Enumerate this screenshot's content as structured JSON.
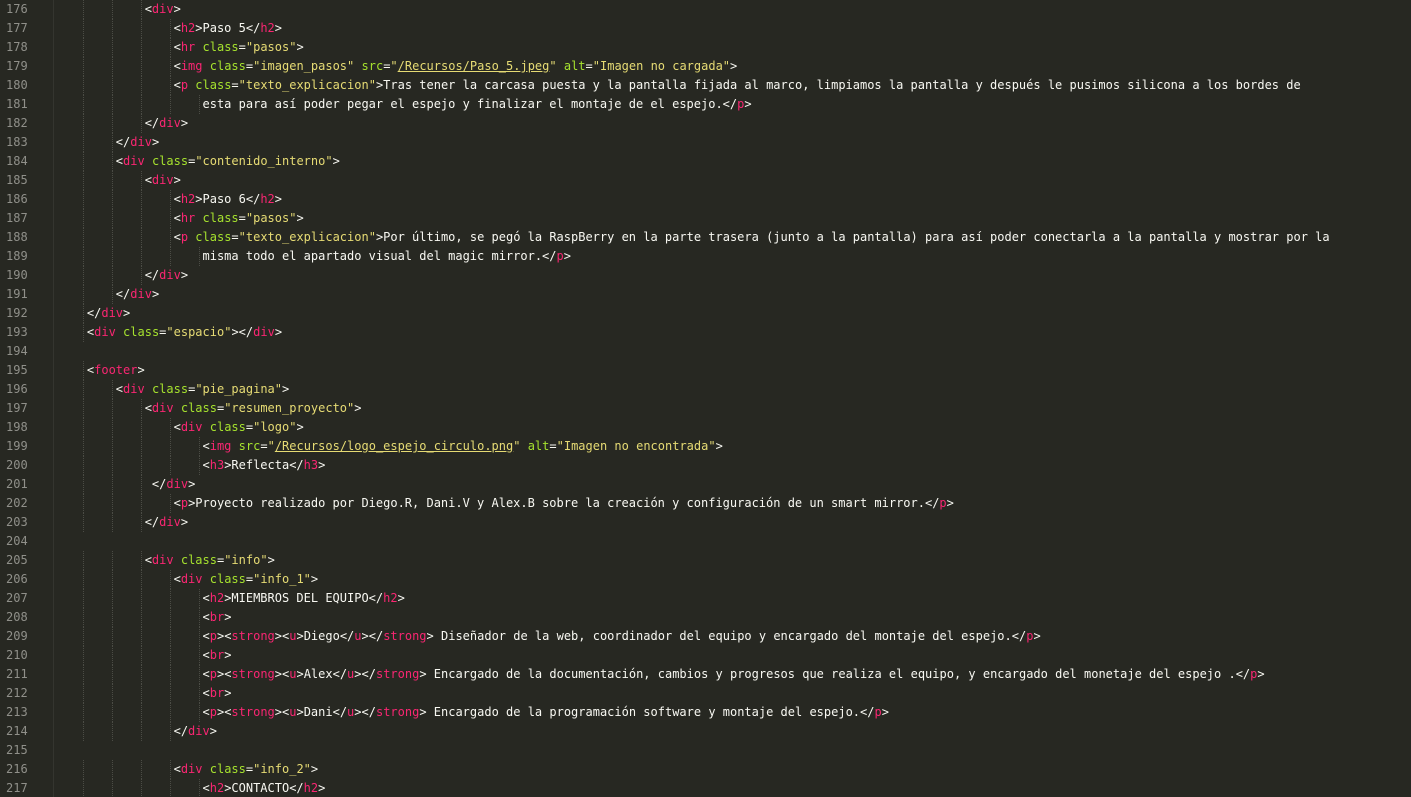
{
  "editor": {
    "theme": "monokai",
    "colors": {
      "background": "#272822",
      "tag": "#f92672",
      "attribute": "#a6e22e",
      "string": "#e6db74",
      "text": "#f8f8f2",
      "line_number": "#90908a"
    }
  },
  "lines": [
    {
      "n": "176",
      "indent": 12,
      "toks": [
        [
          "p",
          "<"
        ],
        [
          "t",
          "div"
        ],
        [
          "p",
          ">"
        ]
      ]
    },
    {
      "n": "177",
      "indent": 16,
      "toks": [
        [
          "p",
          "<"
        ],
        [
          "t",
          "h2"
        ],
        [
          "p",
          ">Paso 5</"
        ],
        [
          "t",
          "h2"
        ],
        [
          "p",
          ">"
        ]
      ]
    },
    {
      "n": "178",
      "indent": 16,
      "toks": [
        [
          "p",
          "<"
        ],
        [
          "t",
          "hr"
        ],
        [
          "p",
          " "
        ],
        [
          "a",
          "class"
        ],
        [
          "p",
          "="
        ],
        [
          "s",
          "\"pasos\""
        ],
        [
          "p",
          ">"
        ]
      ]
    },
    {
      "n": "179",
      "indent": 16,
      "toks": [
        [
          "p",
          "<"
        ],
        [
          "t",
          "img"
        ],
        [
          "p",
          " "
        ],
        [
          "a",
          "class"
        ],
        [
          "p",
          "="
        ],
        [
          "s",
          "\"imagen_pasos\""
        ],
        [
          "p",
          " "
        ],
        [
          "a",
          "src"
        ],
        [
          "p",
          "="
        ],
        [
          "s",
          "\""
        ],
        [
          "u",
          "/Recursos/Paso_5.jpeg"
        ],
        [
          "s",
          "\""
        ],
        [
          "p",
          " "
        ],
        [
          "a",
          "alt"
        ],
        [
          "p",
          "="
        ],
        [
          "s",
          "\"Imagen no cargada\""
        ],
        [
          "p",
          ">"
        ]
      ]
    },
    {
      "n": "180",
      "indent": 16,
      "toks": [
        [
          "p",
          "<"
        ],
        [
          "t",
          "p"
        ],
        [
          "p",
          " "
        ],
        [
          "a",
          "class"
        ],
        [
          "p",
          "="
        ],
        [
          "s",
          "\"texto_explicacion\""
        ],
        [
          "p",
          ">Tras tener la carcasa puesta y la pantalla fijada al marco, limpiamos la pantalla y después le pusimos silicona a los bordes de"
        ]
      ]
    },
    {
      "n": "181",
      "indent": 20,
      "toks": [
        [
          "p",
          "esta para así poder pegar el espejo y finalizar el montaje de el espejo.</"
        ],
        [
          "t",
          "p"
        ],
        [
          "p",
          ">"
        ]
      ]
    },
    {
      "n": "182",
      "indent": 12,
      "toks": [
        [
          "p",
          "</"
        ],
        [
          "t",
          "div"
        ],
        [
          "p",
          ">"
        ]
      ]
    },
    {
      "n": "183",
      "indent": 8,
      "toks": [
        [
          "p",
          "</"
        ],
        [
          "t",
          "div"
        ],
        [
          "p",
          ">"
        ]
      ]
    },
    {
      "n": "184",
      "indent": 8,
      "toks": [
        [
          "p",
          "<"
        ],
        [
          "t",
          "div"
        ],
        [
          "p",
          " "
        ],
        [
          "a",
          "class"
        ],
        [
          "p",
          "="
        ],
        [
          "s",
          "\"contenido_interno\""
        ],
        [
          "p",
          ">"
        ]
      ]
    },
    {
      "n": "185",
      "indent": 12,
      "toks": [
        [
          "p",
          "<"
        ],
        [
          "t",
          "div"
        ],
        [
          "p",
          ">"
        ]
      ]
    },
    {
      "n": "186",
      "indent": 16,
      "toks": [
        [
          "p",
          "<"
        ],
        [
          "t",
          "h2"
        ],
        [
          "p",
          ">Paso 6</"
        ],
        [
          "t",
          "h2"
        ],
        [
          "p",
          ">"
        ]
      ]
    },
    {
      "n": "187",
      "indent": 16,
      "toks": [
        [
          "p",
          "<"
        ],
        [
          "t",
          "hr"
        ],
        [
          "p",
          " "
        ],
        [
          "a",
          "class"
        ],
        [
          "p",
          "="
        ],
        [
          "s",
          "\"pasos\""
        ],
        [
          "p",
          ">"
        ]
      ]
    },
    {
      "n": "188",
      "indent": 16,
      "toks": [
        [
          "p",
          "<"
        ],
        [
          "t",
          "p"
        ],
        [
          "p",
          " "
        ],
        [
          "a",
          "class"
        ],
        [
          "p",
          "="
        ],
        [
          "s",
          "\"texto_explicacion\""
        ],
        [
          "p",
          ">Por último, se pegó la RaspBerry en la parte trasera (junto a la pantalla) para así poder conectarla a la pantalla y mostrar por la"
        ]
      ]
    },
    {
      "n": "189",
      "indent": 20,
      "toks": [
        [
          "p",
          "misma todo el apartado visual del magic mirror.</"
        ],
        [
          "t",
          "p"
        ],
        [
          "p",
          ">"
        ]
      ]
    },
    {
      "n": "190",
      "indent": 12,
      "toks": [
        [
          "p",
          "</"
        ],
        [
          "t",
          "div"
        ],
        [
          "p",
          ">"
        ]
      ]
    },
    {
      "n": "191",
      "indent": 8,
      "toks": [
        [
          "p",
          "</"
        ],
        [
          "t",
          "div"
        ],
        [
          "p",
          ">"
        ]
      ]
    },
    {
      "n": "192",
      "indent": 4,
      "toks": [
        [
          "p",
          "</"
        ],
        [
          "t",
          "div"
        ],
        [
          "p",
          ">"
        ]
      ]
    },
    {
      "n": "193",
      "indent": 4,
      "toks": [
        [
          "p",
          "<"
        ],
        [
          "t",
          "div"
        ],
        [
          "p",
          " "
        ],
        [
          "a",
          "class"
        ],
        [
          "p",
          "="
        ],
        [
          "s",
          "\"espacio\""
        ],
        [
          "p",
          "></"
        ],
        [
          "t",
          "div"
        ],
        [
          "p",
          ">"
        ]
      ]
    },
    {
      "n": "194",
      "indent": 0,
      "toks": []
    },
    {
      "n": "195",
      "indent": 4,
      "toks": [
        [
          "p",
          "<"
        ],
        [
          "t",
          "footer"
        ],
        [
          "p",
          ">"
        ]
      ]
    },
    {
      "n": "196",
      "indent": 8,
      "toks": [
        [
          "p",
          "<"
        ],
        [
          "t",
          "div"
        ],
        [
          "p",
          " "
        ],
        [
          "a",
          "class"
        ],
        [
          "p",
          "="
        ],
        [
          "s",
          "\"pie_pagina\""
        ],
        [
          "p",
          ">"
        ]
      ]
    },
    {
      "n": "197",
      "indent": 12,
      "toks": [
        [
          "p",
          "<"
        ],
        [
          "t",
          "div"
        ],
        [
          "p",
          " "
        ],
        [
          "a",
          "class"
        ],
        [
          "p",
          "="
        ],
        [
          "s",
          "\"resumen_proyecto\""
        ],
        [
          "p",
          ">"
        ]
      ]
    },
    {
      "n": "198",
      "indent": 16,
      "toks": [
        [
          "p",
          "<"
        ],
        [
          "t",
          "div"
        ],
        [
          "p",
          " "
        ],
        [
          "a",
          "class"
        ],
        [
          "p",
          "="
        ],
        [
          "s",
          "\"logo\""
        ],
        [
          "p",
          ">"
        ]
      ]
    },
    {
      "n": "199",
      "indent": 20,
      "toks": [
        [
          "p",
          "<"
        ],
        [
          "t",
          "img"
        ],
        [
          "p",
          " "
        ],
        [
          "a",
          "src"
        ],
        [
          "p",
          "="
        ],
        [
          "s",
          "\""
        ],
        [
          "u",
          "/Recursos/logo_espejo_circulo.png"
        ],
        [
          "s",
          "\""
        ],
        [
          "p",
          " "
        ],
        [
          "a",
          "alt"
        ],
        [
          "p",
          "="
        ],
        [
          "s",
          "\"Imagen no encontrada\""
        ],
        [
          "p",
          ">"
        ]
      ]
    },
    {
      "n": "200",
      "indent": 20,
      "toks": [
        [
          "p",
          "<"
        ],
        [
          "t",
          "h3"
        ],
        [
          "p",
          ">Reflecta</"
        ],
        [
          "t",
          "h3"
        ],
        [
          "p",
          ">"
        ]
      ]
    },
    {
      "n": "201",
      "indent": 13,
      "toks": [
        [
          "p",
          "</"
        ],
        [
          "t",
          "div"
        ],
        [
          "p",
          ">"
        ]
      ]
    },
    {
      "n": "202",
      "indent": 16,
      "toks": [
        [
          "p",
          "<"
        ],
        [
          "t",
          "p"
        ],
        [
          "p",
          ">Proyecto realizado por Diego.R, Dani.V y Alex.B sobre la creación y configuración de un smart mirror.</"
        ],
        [
          "t",
          "p"
        ],
        [
          "p",
          ">"
        ]
      ]
    },
    {
      "n": "203",
      "indent": 12,
      "toks": [
        [
          "p",
          "</"
        ],
        [
          "t",
          "div"
        ],
        [
          "p",
          ">"
        ]
      ]
    },
    {
      "n": "204",
      "indent": 0,
      "toks": []
    },
    {
      "n": "205",
      "indent": 12,
      "toks": [
        [
          "p",
          "<"
        ],
        [
          "t",
          "div"
        ],
        [
          "p",
          " "
        ],
        [
          "a",
          "class"
        ],
        [
          "p",
          "="
        ],
        [
          "s",
          "\"info\""
        ],
        [
          "p",
          ">"
        ]
      ]
    },
    {
      "n": "206",
      "indent": 16,
      "toks": [
        [
          "p",
          "<"
        ],
        [
          "t",
          "div"
        ],
        [
          "p",
          " "
        ],
        [
          "a",
          "class"
        ],
        [
          "p",
          "="
        ],
        [
          "s",
          "\"info_1\""
        ],
        [
          "p",
          ">"
        ]
      ]
    },
    {
      "n": "207",
      "indent": 20,
      "toks": [
        [
          "p",
          "<"
        ],
        [
          "t",
          "h2"
        ],
        [
          "p",
          ">MIEMBROS DEL EQUIPO</"
        ],
        [
          "t",
          "h2"
        ],
        [
          "p",
          ">"
        ]
      ]
    },
    {
      "n": "208",
      "indent": 20,
      "toks": [
        [
          "p",
          "<"
        ],
        [
          "t",
          "br"
        ],
        [
          "p",
          ">"
        ]
      ]
    },
    {
      "n": "209",
      "indent": 20,
      "toks": [
        [
          "p",
          "<"
        ],
        [
          "t",
          "p"
        ],
        [
          "p",
          "><"
        ],
        [
          "t",
          "strong"
        ],
        [
          "p",
          "><"
        ],
        [
          "t",
          "u"
        ],
        [
          "p",
          ">Diego</"
        ],
        [
          "t",
          "u"
        ],
        [
          "p",
          "></"
        ],
        [
          "t",
          "strong"
        ],
        [
          "p",
          "> Diseñador de la web, coordinador del equipo y encargado del montaje del espejo.</"
        ],
        [
          "t",
          "p"
        ],
        [
          "p",
          ">"
        ]
      ]
    },
    {
      "n": "210",
      "indent": 20,
      "toks": [
        [
          "p",
          "<"
        ],
        [
          "t",
          "br"
        ],
        [
          "p",
          ">"
        ]
      ]
    },
    {
      "n": "211",
      "indent": 20,
      "toks": [
        [
          "p",
          "<"
        ],
        [
          "t",
          "p"
        ],
        [
          "p",
          "><"
        ],
        [
          "t",
          "strong"
        ],
        [
          "p",
          "><"
        ],
        [
          "t",
          "u"
        ],
        [
          "p",
          ">Alex</"
        ],
        [
          "t",
          "u"
        ],
        [
          "p",
          "></"
        ],
        [
          "t",
          "strong"
        ],
        [
          "p",
          "> Encargado de la documentación, cambios y progresos que realiza el equipo, y encargado del monetaje del espejo .</"
        ],
        [
          "t",
          "p"
        ],
        [
          "p",
          ">"
        ]
      ]
    },
    {
      "n": "212",
      "indent": 20,
      "toks": [
        [
          "p",
          "<"
        ],
        [
          "t",
          "br"
        ],
        [
          "p",
          ">"
        ]
      ]
    },
    {
      "n": "213",
      "indent": 20,
      "toks": [
        [
          "p",
          "<"
        ],
        [
          "t",
          "p"
        ],
        [
          "p",
          "><"
        ],
        [
          "t",
          "strong"
        ],
        [
          "p",
          "><"
        ],
        [
          "t",
          "u"
        ],
        [
          "p",
          ">Dani</"
        ],
        [
          "t",
          "u"
        ],
        [
          "p",
          "></"
        ],
        [
          "t",
          "strong"
        ],
        [
          "p",
          "> Encargado de la programación software y montaje del espejo.</"
        ],
        [
          "t",
          "p"
        ],
        [
          "p",
          ">"
        ]
      ]
    },
    {
      "n": "214",
      "indent": 16,
      "toks": [
        [
          "p",
          "</"
        ],
        [
          "t",
          "div"
        ],
        [
          "p",
          ">"
        ]
      ]
    },
    {
      "n": "215",
      "indent": 0,
      "toks": []
    },
    {
      "n": "216",
      "indent": 16,
      "toks": [
        [
          "p",
          "<"
        ],
        [
          "t",
          "div"
        ],
        [
          "p",
          " "
        ],
        [
          "a",
          "class"
        ],
        [
          "p",
          "="
        ],
        [
          "s",
          "\"info_2\""
        ],
        [
          "p",
          ">"
        ]
      ]
    },
    {
      "n": "217",
      "indent": 20,
      "toks": [
        [
          "p",
          "<"
        ],
        [
          "t",
          "h2"
        ],
        [
          "p",
          ">CONTACTO</"
        ],
        [
          "t",
          "h2"
        ],
        [
          "p",
          ">"
        ]
      ]
    }
  ]
}
